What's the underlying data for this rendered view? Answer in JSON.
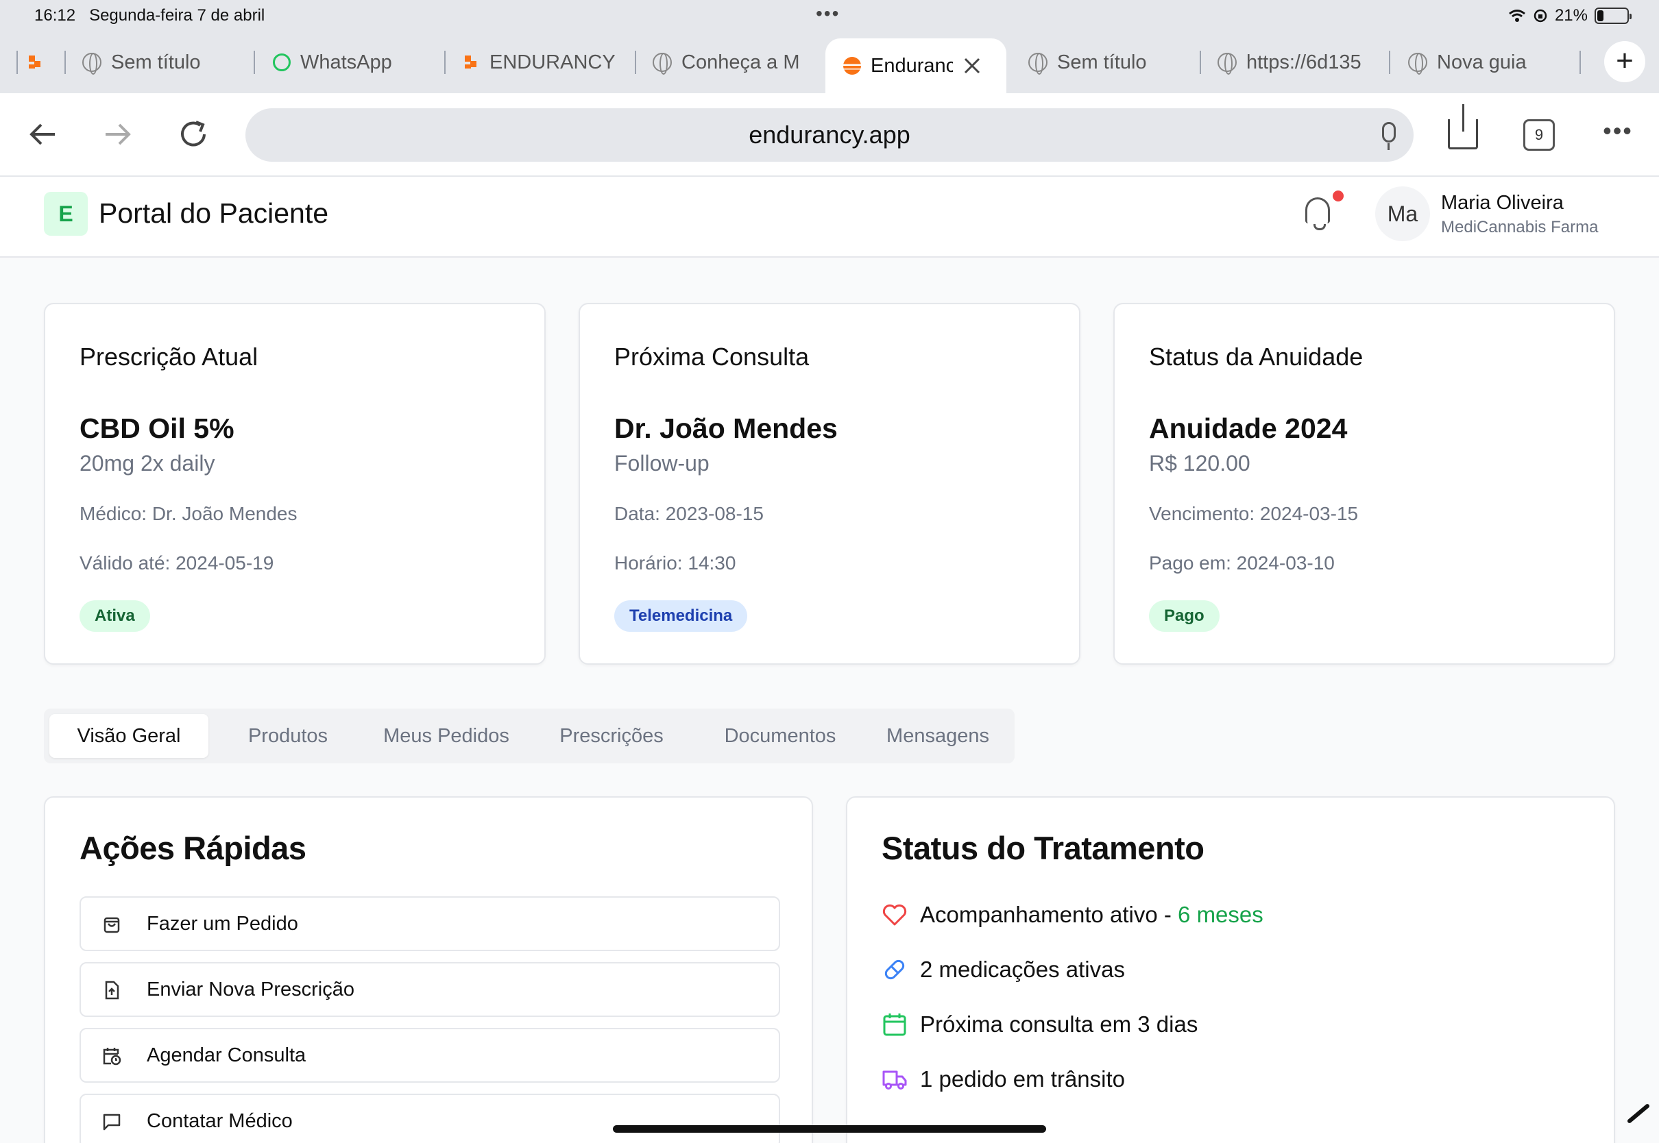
{
  "status_bar": {
    "time": "16:12",
    "date": "Segunda-feira 7 de abril",
    "battery": "21%",
    "battery_level": 0.21
  },
  "browser": {
    "tabs": [
      {
        "label": "",
        "icon": "endurancy-logo"
      },
      {
        "label": "Sem título",
        "icon": "globe-icon"
      },
      {
        "label": "WhatsApp",
        "icon": "whatsapp-icon"
      },
      {
        "label": "ENDURANCY",
        "icon": "endurancy-logo"
      },
      {
        "label": "Conheça a M",
        "icon": "globe-icon"
      },
      {
        "label": "Enduranc",
        "icon": "sunset-icon",
        "active": true
      },
      {
        "label": "Sem título",
        "icon": "globe-icon"
      },
      {
        "label": "https://6d135",
        "icon": "globe-icon"
      },
      {
        "label": "Nova guia",
        "icon": "globe-icon"
      }
    ],
    "url": "endurancy.app",
    "tab_count": "9"
  },
  "app": {
    "logo_letter": "E",
    "title": "Portal do Paciente",
    "user": {
      "initials": "Ma",
      "name": "Maria Oliveira",
      "company": "MediCannabis Farma"
    }
  },
  "cards": [
    {
      "title": "Prescrição Atual",
      "main": "CBD Oil 5%",
      "sub": "20mg 2x daily",
      "line1": "Médico: Dr. João Mendes",
      "line2": "Válido até: 2024-05-19",
      "badge": "Ativa"
    },
    {
      "title": "Próxima Consulta",
      "main": "Dr. João Mendes",
      "sub": "Follow-up",
      "line1": "Data: 2023-08-15",
      "line2": "Horário: 14:30",
      "badge": "Telemedicina"
    },
    {
      "title": "Status da Anuidade",
      "main": "Anuidade 2024",
      "sub": "R$ 120.00",
      "line1": "Vencimento: 2024-03-15",
      "line2": "Pago em: 2024-03-10",
      "badge": "Pago"
    }
  ],
  "tabs": [
    "Visão Geral",
    "Produtos",
    "Meus Pedidos",
    "Prescrições",
    "Documentos",
    "Mensagens"
  ],
  "quick_actions": {
    "title": "Ações Rápidas",
    "items": [
      {
        "label": "Fazer um Pedido",
        "icon": "shopping-bag-icon"
      },
      {
        "label": "Enviar Nova Prescrição",
        "icon": "file-upload-icon"
      },
      {
        "label": "Agendar Consulta",
        "icon": "calendar-clock-icon"
      },
      {
        "label": "Contatar Médico",
        "icon": "message-icon"
      }
    ]
  },
  "treatment": {
    "title": "Status do Tratamento",
    "items": [
      {
        "text": "Acompanhamento ativo - ",
        "highlight": "6 meses",
        "icon": "heart-icon",
        "color": "#ef4444"
      },
      {
        "text": "2 medicações ativas",
        "icon": "pill-icon",
        "color": "#3b82f6"
      },
      {
        "text": "Próxima consulta em 3 dias",
        "icon": "calendar-icon",
        "color": "#22c55e"
      },
      {
        "text": "1 pedido em trânsito",
        "icon": "truck-icon",
        "color": "#a855f7"
      }
    ]
  },
  "colors": {
    "accent_green": "#16a34a",
    "badge_green_bg": "#dcfce7",
    "badge_blue_bg": "#dbeafe",
    "notification_dot": "#ef4444"
  }
}
